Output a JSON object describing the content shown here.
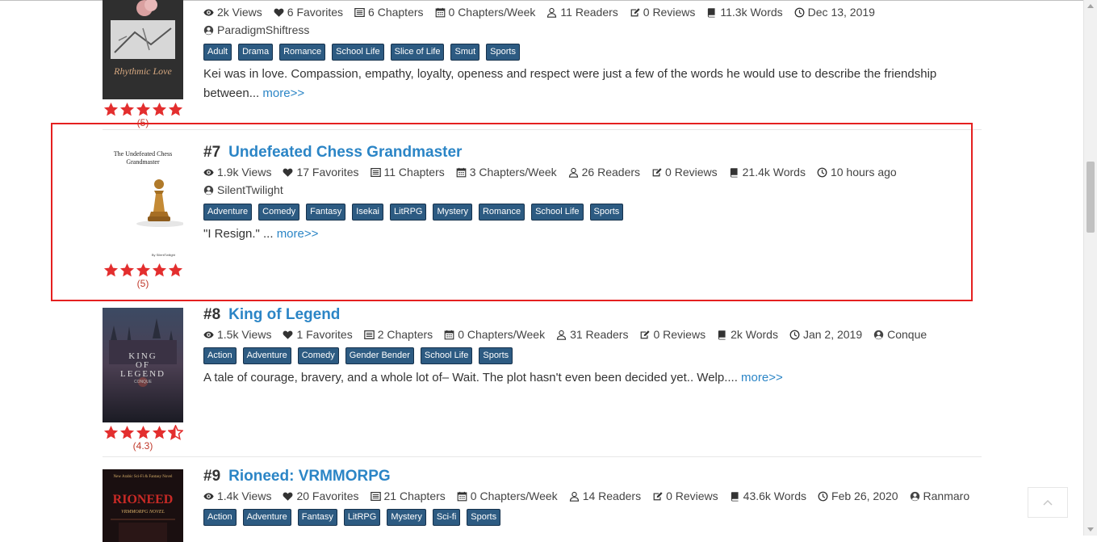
{
  "colors": {
    "accent": "#2b85c6",
    "tag_bg": "#2d5b82",
    "star": "#e32e2e",
    "highlight": "#e52020"
  },
  "items": [
    {
      "rank": "",
      "title": "",
      "cover_text": "Rhythmic Love",
      "stats": {
        "views": "2k Views",
        "favorites": "6 Favorites",
        "chapters": "6 Chapters",
        "chapters_week": "0 Chapters/Week",
        "readers": "11 Readers",
        "reviews": "0 Reviews",
        "words": "11.3k Words",
        "date": "Dec 13, 2019"
      },
      "author": "ParadigmShiftress",
      "tags": [
        "Adult",
        "Drama",
        "Romance",
        "School Life",
        "Slice of Life",
        "Smut",
        "Sports"
      ],
      "description": "Kei was in love. Compassion, empathy, loyalty, openess and respect were just a few of the words he would use to describe the friendship between...",
      "more": "more>>",
      "rating": 5,
      "rating_count": "(5)"
    },
    {
      "rank": "#7",
      "title": "Undefeated Chess Grandmaster",
      "cover_text": "The Undefeated Chess Grandmaster",
      "cover_author": "By SilentTwilight",
      "stats": {
        "views": "1.9k Views",
        "favorites": "17 Favorites",
        "chapters": "11 Chapters",
        "chapters_week": "3 Chapters/Week",
        "readers": "26 Readers",
        "reviews": "0 Reviews",
        "words": "21.4k Words",
        "date": "10 hours ago"
      },
      "author": "SilentTwilight",
      "tags": [
        "Adventure",
        "Comedy",
        "Fantasy",
        "Isekai",
        "LitRPG",
        "Mystery",
        "Romance",
        "School Life",
        "Sports"
      ],
      "description": "\"I Resign.\" ...",
      "more": "more>>",
      "rating": 5,
      "rating_count": "(5)"
    },
    {
      "rank": "#8",
      "title": "King of Legend",
      "cover_text": "KING OF LEGEND",
      "cover_author": "CONQUE",
      "stats": {
        "views": "1.5k Views",
        "favorites": "1 Favorites",
        "chapters": "2 Chapters",
        "chapters_week": "0 Chapters/Week",
        "readers": "31 Readers",
        "reviews": "0 Reviews",
        "words": "2k Words",
        "date": "Jan 2, 2019"
      },
      "author": "Conque",
      "tags": [
        "Action",
        "Adventure",
        "Comedy",
        "Gender Bender",
        "School Life",
        "Sports"
      ],
      "description": "A tale of courage, bravery, and a whole lot of– Wait. The plot hasn't even been decided yet.. Welp....",
      "more": "more>>",
      "rating": 4.3,
      "rating_count": "(4.3)"
    },
    {
      "rank": "#9",
      "title": "Rioneed: VRMMORPG",
      "cover_text": "RIONEED",
      "cover_top": "New Arabic Sci-Fi & Fantasy Novel",
      "cover_sub": "VRMMORPG NOVEL",
      "stats": {
        "views": "1.4k Views",
        "favorites": "20 Favorites",
        "chapters": "21 Chapters",
        "chapters_week": "0 Chapters/Week",
        "readers": "14 Readers",
        "reviews": "0 Reviews",
        "words": "43.6k Words",
        "date": "Feb 26, 2020"
      },
      "author": "Ranmaro",
      "tags": [
        "Action",
        "Adventure",
        "Fantasy",
        "LitRPG",
        "Mystery",
        "Sci-fi",
        "Sports"
      ]
    }
  ]
}
